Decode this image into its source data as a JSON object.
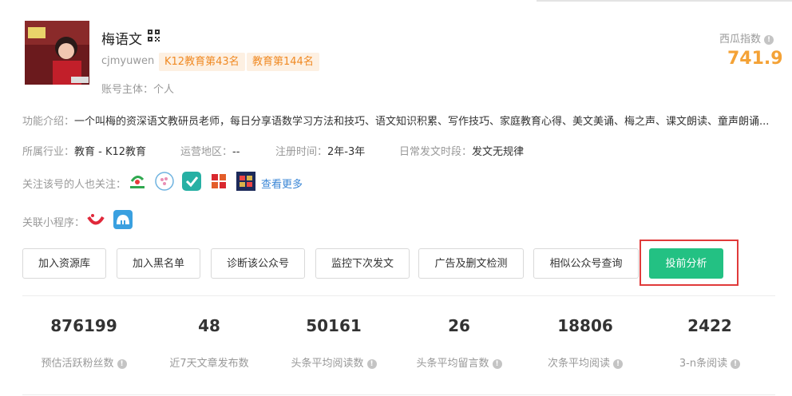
{
  "account": {
    "name": "梅语文",
    "handle": "cjmyuwen",
    "tags": [
      "K12教育第43名",
      "教育第144名"
    ],
    "subject_label": "账号主体：",
    "subject_value": "个人",
    "index_label": "西瓜指数",
    "index_value": "741.9"
  },
  "intro": {
    "label": "功能介绍：",
    "text": "一个叫梅的资深语文教研员老师，每日分享语数学习方法和技巧、语文知识积累、写作技巧、家庭教育心得、美文美诵、梅之声、课文朗读、童声朗诵..."
  },
  "meta": {
    "industry_label": "所属行业：",
    "industry_value": "教育 - K12教育",
    "region_label": "运营地区：",
    "region_value": "--",
    "reg_label": "注册时间：",
    "reg_value": "2年-3年",
    "post_label": "日常发文时段：",
    "post_value": "发文无规律"
  },
  "follow": {
    "label": "关注该号的人也关注：",
    "icons": [
      "follow-account-1-icon",
      "follow-account-2-icon",
      "follow-account-3-icon",
      "follow-account-4-icon",
      "follow-account-5-icon"
    ],
    "see_more": "查看更多"
  },
  "mini": {
    "label": "关联小程序：",
    "icons": [
      "mini-program-1-icon",
      "mini-program-2-icon"
    ]
  },
  "buttons": [
    "加入资源库",
    "加入黑名单",
    "诊断该公众号",
    "监控下次发文",
    "广告及删文检测",
    "相似公众号查询",
    "投前分析"
  ],
  "stats": [
    {
      "value": "876199",
      "label": "预估活跃粉丝数"
    },
    {
      "value": "48",
      "label": "近7天文章发布数"
    },
    {
      "value": "50161",
      "label": "头条平均阅读数"
    },
    {
      "value": "26",
      "label": "头条平均留言数"
    },
    {
      "value": "18806",
      "label": "次条平均阅读"
    },
    {
      "value": "2422",
      "label": "3-n条阅读"
    }
  ],
  "colors": {
    "accent_orange": "#f4a236",
    "tag_bg": "#fdf0e2",
    "primary_green": "#23c183",
    "highlight_red": "#e03a3a",
    "link_blue": "#3a86d6"
  }
}
